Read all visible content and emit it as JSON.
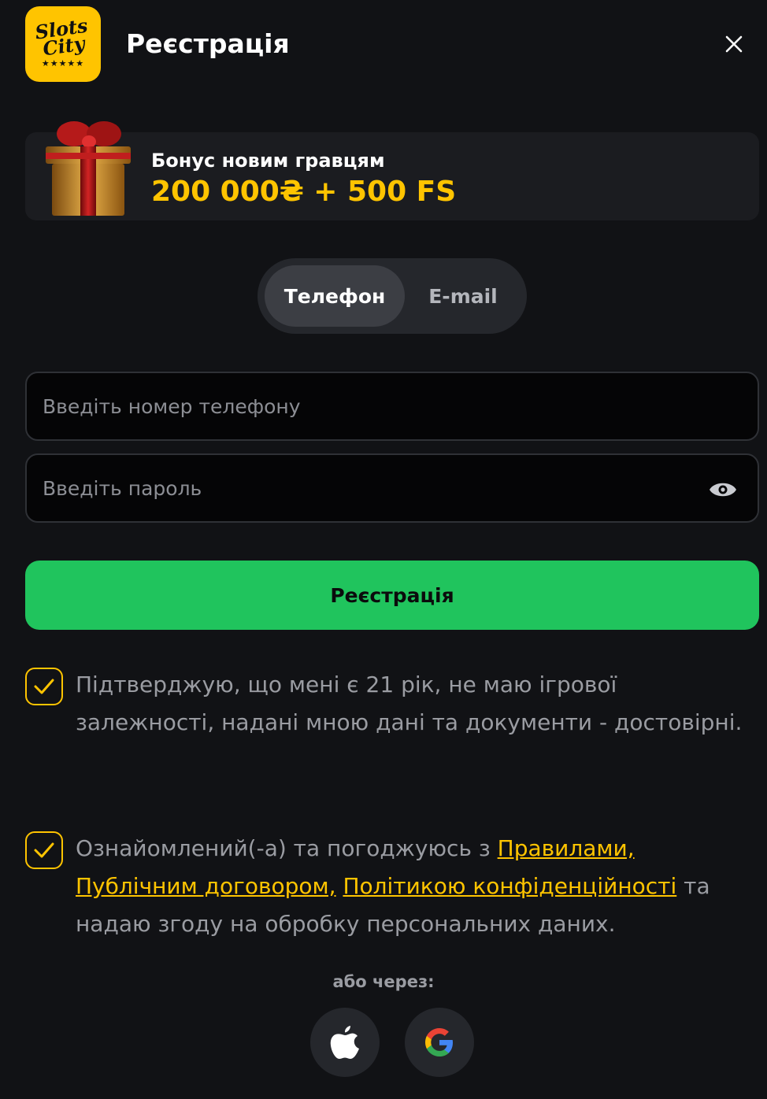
{
  "header": {
    "logo_text_line1": "Slots",
    "logo_text_line2": "City",
    "logo_stars": "★★★★★",
    "title": "Реєстрація",
    "close_icon": "close-icon"
  },
  "bonus": {
    "label": "Бонус новим гравцям",
    "amount": "200 000₴ + 500 FS",
    "icon": "gift-icon"
  },
  "tabs": [
    {
      "label": "Телефон",
      "active": true
    },
    {
      "label": "E-mail",
      "active": false
    }
  ],
  "form": {
    "phone_placeholder": "Введіть номер телефону",
    "password_placeholder": "Введіть пароль",
    "phone_value": "",
    "password_value": "",
    "submit_label": "Реєстрація"
  },
  "agreements": {
    "age_text": "Підтверджую, що мені є 21 рік, не маю ігрової залежності, надані мною дані та документи - достовірні.",
    "terms_prefix": "Ознайомлений(-а) та погоджуюсь з ",
    "rules_link": "Правилами,",
    "contract_link": "Публічним договором,",
    "privacy_link": "Політикою конфіденційності",
    "terms_suffix": " та надаю згоду на обробку персональних даних."
  },
  "social": {
    "label": "або через:",
    "apple_icon": "apple-icon",
    "google_icon": "google-icon"
  },
  "colors": {
    "accent": "#FFC400",
    "submit": "#20C45D",
    "background": "#111215"
  }
}
